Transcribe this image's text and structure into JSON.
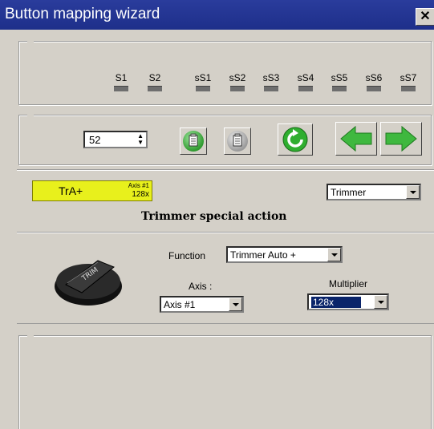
{
  "window": {
    "title": "Button mapping wizard",
    "close_glyph": "✕"
  },
  "indicators": [
    {
      "label": "S1"
    },
    {
      "label": "S2"
    },
    {
      "label": "sS1"
    },
    {
      "label": "sS2"
    },
    {
      "label": "sS3"
    },
    {
      "label": "sS4"
    },
    {
      "label": "sS5"
    },
    {
      "label": "sS6"
    },
    {
      "label": "sS7"
    }
  ],
  "toolbar": {
    "spinner_value": "52",
    "buttons": [
      "copy-icon",
      "paste-icon",
      "reset-icon",
      "arrow-left-icon",
      "arrow-right-icon"
    ]
  },
  "mapping": {
    "chip_label": "TrA+",
    "chip_axis": "Axis #1",
    "chip_mult": "128x",
    "type_select": "Trimmer",
    "section_title": "Trimmer special action"
  },
  "action": {
    "function_label": "Function",
    "function_value": "Trimmer Auto +",
    "axis_label": "Axis :",
    "axis_value": "Axis #1",
    "multiplier_label": "Multiplier",
    "multiplier_value": "128x",
    "knob_text": "TRIM"
  },
  "colors": {
    "chip_bg": "#e8f01c",
    "selected_bg": "#0a246a",
    "title_bg": "#1e2f8a"
  }
}
